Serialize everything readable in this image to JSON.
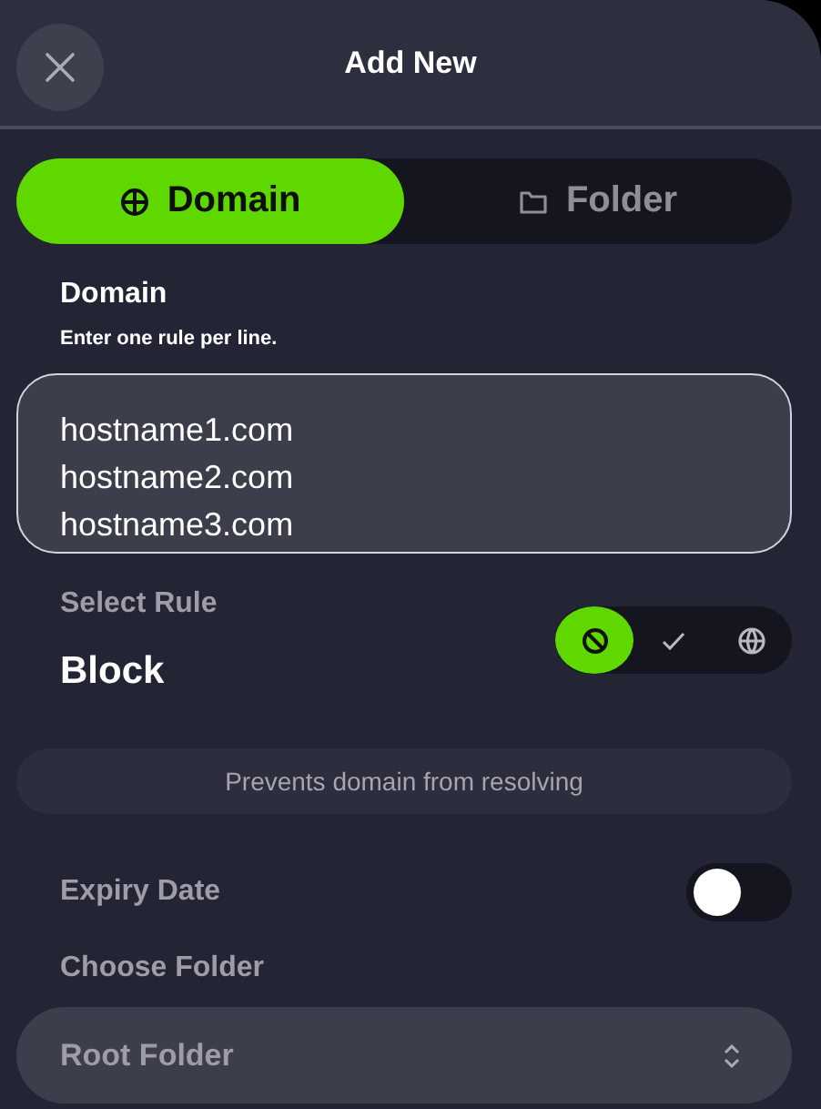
{
  "window": {
    "title": "Add New"
  },
  "tabs": [
    {
      "label": "Domain",
      "kind": "globe",
      "selected": true
    },
    {
      "label": "Folder",
      "kind": "folder",
      "selected": false
    }
  ],
  "domain_field": {
    "label": "Domain",
    "hint": "Enter one rule per line.",
    "value": "hostname1.com\nhostname2.com\nhostname3.com"
  },
  "rule": {
    "label": "Select Rule",
    "value": "Block",
    "description": "Prevents domain from resolving",
    "options": [
      {
        "kind": "block",
        "selected": true
      },
      {
        "kind": "allow",
        "selected": false
      },
      {
        "kind": "redirect",
        "selected": false
      }
    ]
  },
  "expiry": {
    "label": "Expiry Date",
    "on": false
  },
  "folder": {
    "label": "Choose Folder",
    "value": "Root Folder"
  }
}
